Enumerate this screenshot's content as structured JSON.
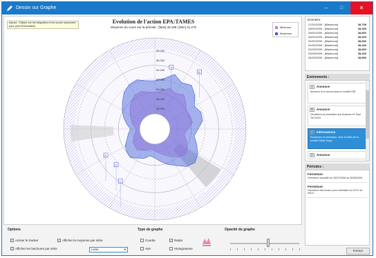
{
  "window": {
    "title": "Dessin sur Graphe"
  },
  "chart": {
    "title": "Evolution de l'action EPA:TAMES",
    "subtitle": "Moyenne du cours sur la période : [Max] 46,188 | [Min] 31,278",
    "hint": "Astuce : Glisser sur les étiquettes et les zones hachurées pour plus d'information.",
    "legend": [
      {
        "label": "Minimum",
        "color": "#c97ad8"
      },
      {
        "label": "Maximum",
        "color": "#3b5bd8"
      }
    ],
    "ring_labels": [
      "58.000",
      "56.000",
      "54.000",
      "52.000",
      "50.000",
      "48.000",
      "46.000"
    ],
    "markers": [
      "A",
      "B",
      "C",
      "D",
      "E"
    ]
  },
  "chart_data": {
    "type": "area",
    "series": [
      {
        "name": "Maximum",
        "color": "#3b5bd8",
        "values": [
          52.5,
          53.0,
          54.2,
          53.4,
          54.0,
          53.2,
          52.0,
          52.6,
          52.5,
          51.6,
          51.0,
          51.8,
          52.7,
          53.2,
          52.6,
          51.4,
          50.6,
          49.8,
          49.1,
          48.8,
          49.5,
          49.9,
          50.6,
          50.4,
          50.0,
          49.2,
          48.7,
          48.3,
          49.0,
          49.8,
          50.6,
          51.4,
          52.4,
          53.0,
          53.2,
          52.6
        ]
      },
      {
        "name": "Minimum",
        "color": "#c97ad8",
        "values": [
          50.4,
          50.8,
          51.6,
          51.2,
          51.9,
          51.1,
          50.4,
          50.6,
          50.7,
          49.8,
          49.2,
          49.9,
          50.6,
          51.0,
          50.4,
          49.6,
          48.9,
          48.3,
          47.8,
          47.6,
          48.0,
          48.3,
          48.8,
          48.6,
          48.4,
          47.9,
          47.5,
          47.3,
          47.8,
          48.4,
          49.0,
          49.7,
          50.4,
          50.9,
          51.0,
          50.6
        ]
      }
    ],
    "rlim": [
      44,
      60
    ]
  },
  "data_list": {
    "header": "Données :",
    "rows": [
      {
        "label": "27/01/2009 - [Maximum]",
        "value": "38,798"
      },
      {
        "label": "28/01/2009 - [Maximum]",
        "value": "38,399"
      },
      {
        "label": "29/01/2009 - [Maximum]",
        "value": "38,800"
      },
      {
        "label": "30/01/2009 - [Maximum]",
        "value": "38,400"
      },
      {
        "label": "31/01/2009 - [Maximum]",
        "value": "38,830"
      },
      {
        "label": "01/02/2009 - [Maximum]",
        "value": "38,430"
      },
      {
        "label": "02/02/2009 - [Maximum]",
        "value": "38,830"
      },
      {
        "label": "03/02/2009 - [Maximum]",
        "value": "38,430"
      },
      {
        "label": "04/02/2009 - [Maximum]",
        "value": "38,890"
      }
    ]
  },
  "events": {
    "header": "Evénements :",
    "items": [
      {
        "tag": "A",
        "title": "Annonce",
        "body": "Annonce d'un accord avec le société KBI"
      },
      {
        "tag": "B",
        "title": "Annonce",
        "body": "Démission du secrétaire aux finances M. Paul TACHON"
      },
      {
        "tag": "C",
        "title": "Informations",
        "body": "Expansion en Amérique, avec 15 sites de la société Wells Fargo."
      },
      {
        "tag": "D",
        "title": "Annonce",
        "body": ""
      }
    ]
  },
  "periods": {
    "header": "Périodes :",
    "items": [
      {
        "title": "Fermeture",
        "body": "Fermeture annuelle du 30/07/2008 au 30/08/2008"
      },
      {
        "title": "Fermeture",
        "body": "Fermeture des locaux pour inventaire du 01/12 au 05/12"
      }
    ]
  },
  "close_button": "Fermer",
  "options": {
    "title": "Options",
    "activate_tracker": "Activer le tracker",
    "show_average": "Afficher la moyenne par série",
    "show_stripes": "Afficher les hachures par série",
    "mode_value": "Lisse"
  },
  "graph_type": {
    "title": "Type de graphe",
    "items": [
      "Courbe",
      "Radar",
      "Aire",
      "Histogramme"
    ]
  },
  "opacity": {
    "title": "Opacité du graphe",
    "level": 0.55
  }
}
